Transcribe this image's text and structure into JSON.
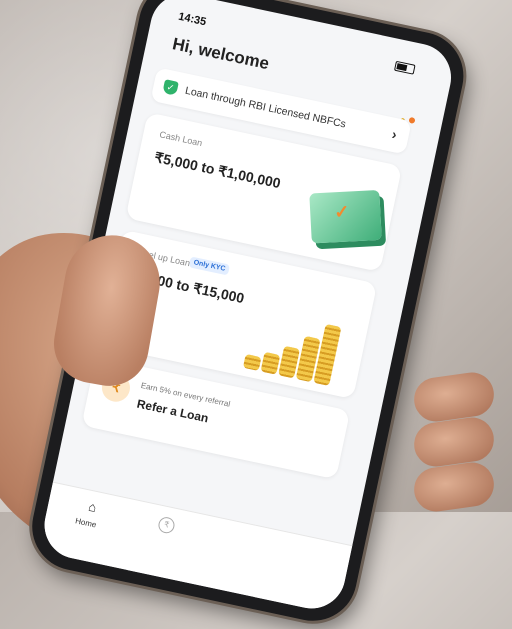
{
  "status": {
    "time": "14:35"
  },
  "header": {
    "greeting": "Hi, welcome"
  },
  "banner": {
    "text": "Loan through RBI Licensed NBFCs"
  },
  "cards": [
    {
      "label": "Cash Loan",
      "amount": "₹5,000 to ₹1,00,000"
    },
    {
      "label": "Level up Loan",
      "badge": "Only KYC",
      "amount": "₹1,000 to ₹15,000"
    }
  ],
  "referral": {
    "subtitle": "Earn 5% on every referral",
    "title": "Refer a Loan"
  },
  "nav": {
    "home_label": "Home"
  },
  "colors": {
    "accent_green": "#2fb36b",
    "badge_blue": "#2b6fd6",
    "coin_gold": "#f3c94a"
  }
}
